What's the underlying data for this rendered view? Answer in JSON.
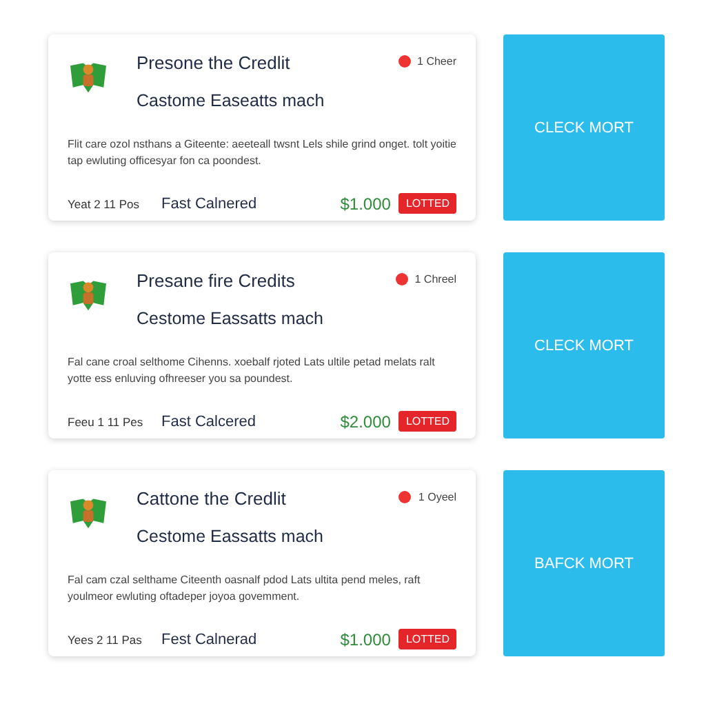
{
  "offers": [
    {
      "title": "Presone the Credlit",
      "meta": "1 Cheer",
      "subtitle": "Castome Easeatts mach",
      "description": "Flit care ozol nsthans a Giteente: aeeteall twsnt Lels shile grind onget. tolt yoitie tap ewluting officesyar fon ca poondest.",
      "footer_left": "Yeat 2 11 Pos",
      "footer_label": "Fast Calnered",
      "price": "$1.000",
      "badge": "LOTTED",
      "action": "CLECK MORT"
    },
    {
      "title": "Presane fire Credits",
      "meta": "1 Chreel",
      "subtitle": "Cestome Eassatts mach",
      "description": "Fal cane croal selthome Cihenns. xoebalf rjoted Lats ultile petad melats ralt yotte ess enluving ofhreeser you sa poundest.",
      "footer_left": "Feeu 1 11 Pes",
      "footer_label": "Fast Calcered",
      "price": "$2.000",
      "badge": "LOTTED",
      "action": "CLECK MORT"
    },
    {
      "title": "Cattone the Credlit",
      "meta": "1 Oyeel",
      "subtitle": "Cestome Eassatts mach",
      "description": "Fal cam czal selthame Citeenth oasnalf pdod Lats ultita pend meles, raft youlmeor ewluting oftadeper joyoa govemment.",
      "footer_left": "Yees 2 11 Pas",
      "footer_label": "Fest Calnerad",
      "price": "$1.000",
      "badge": "LOTTED",
      "action": "BAFCK MORT"
    }
  ]
}
